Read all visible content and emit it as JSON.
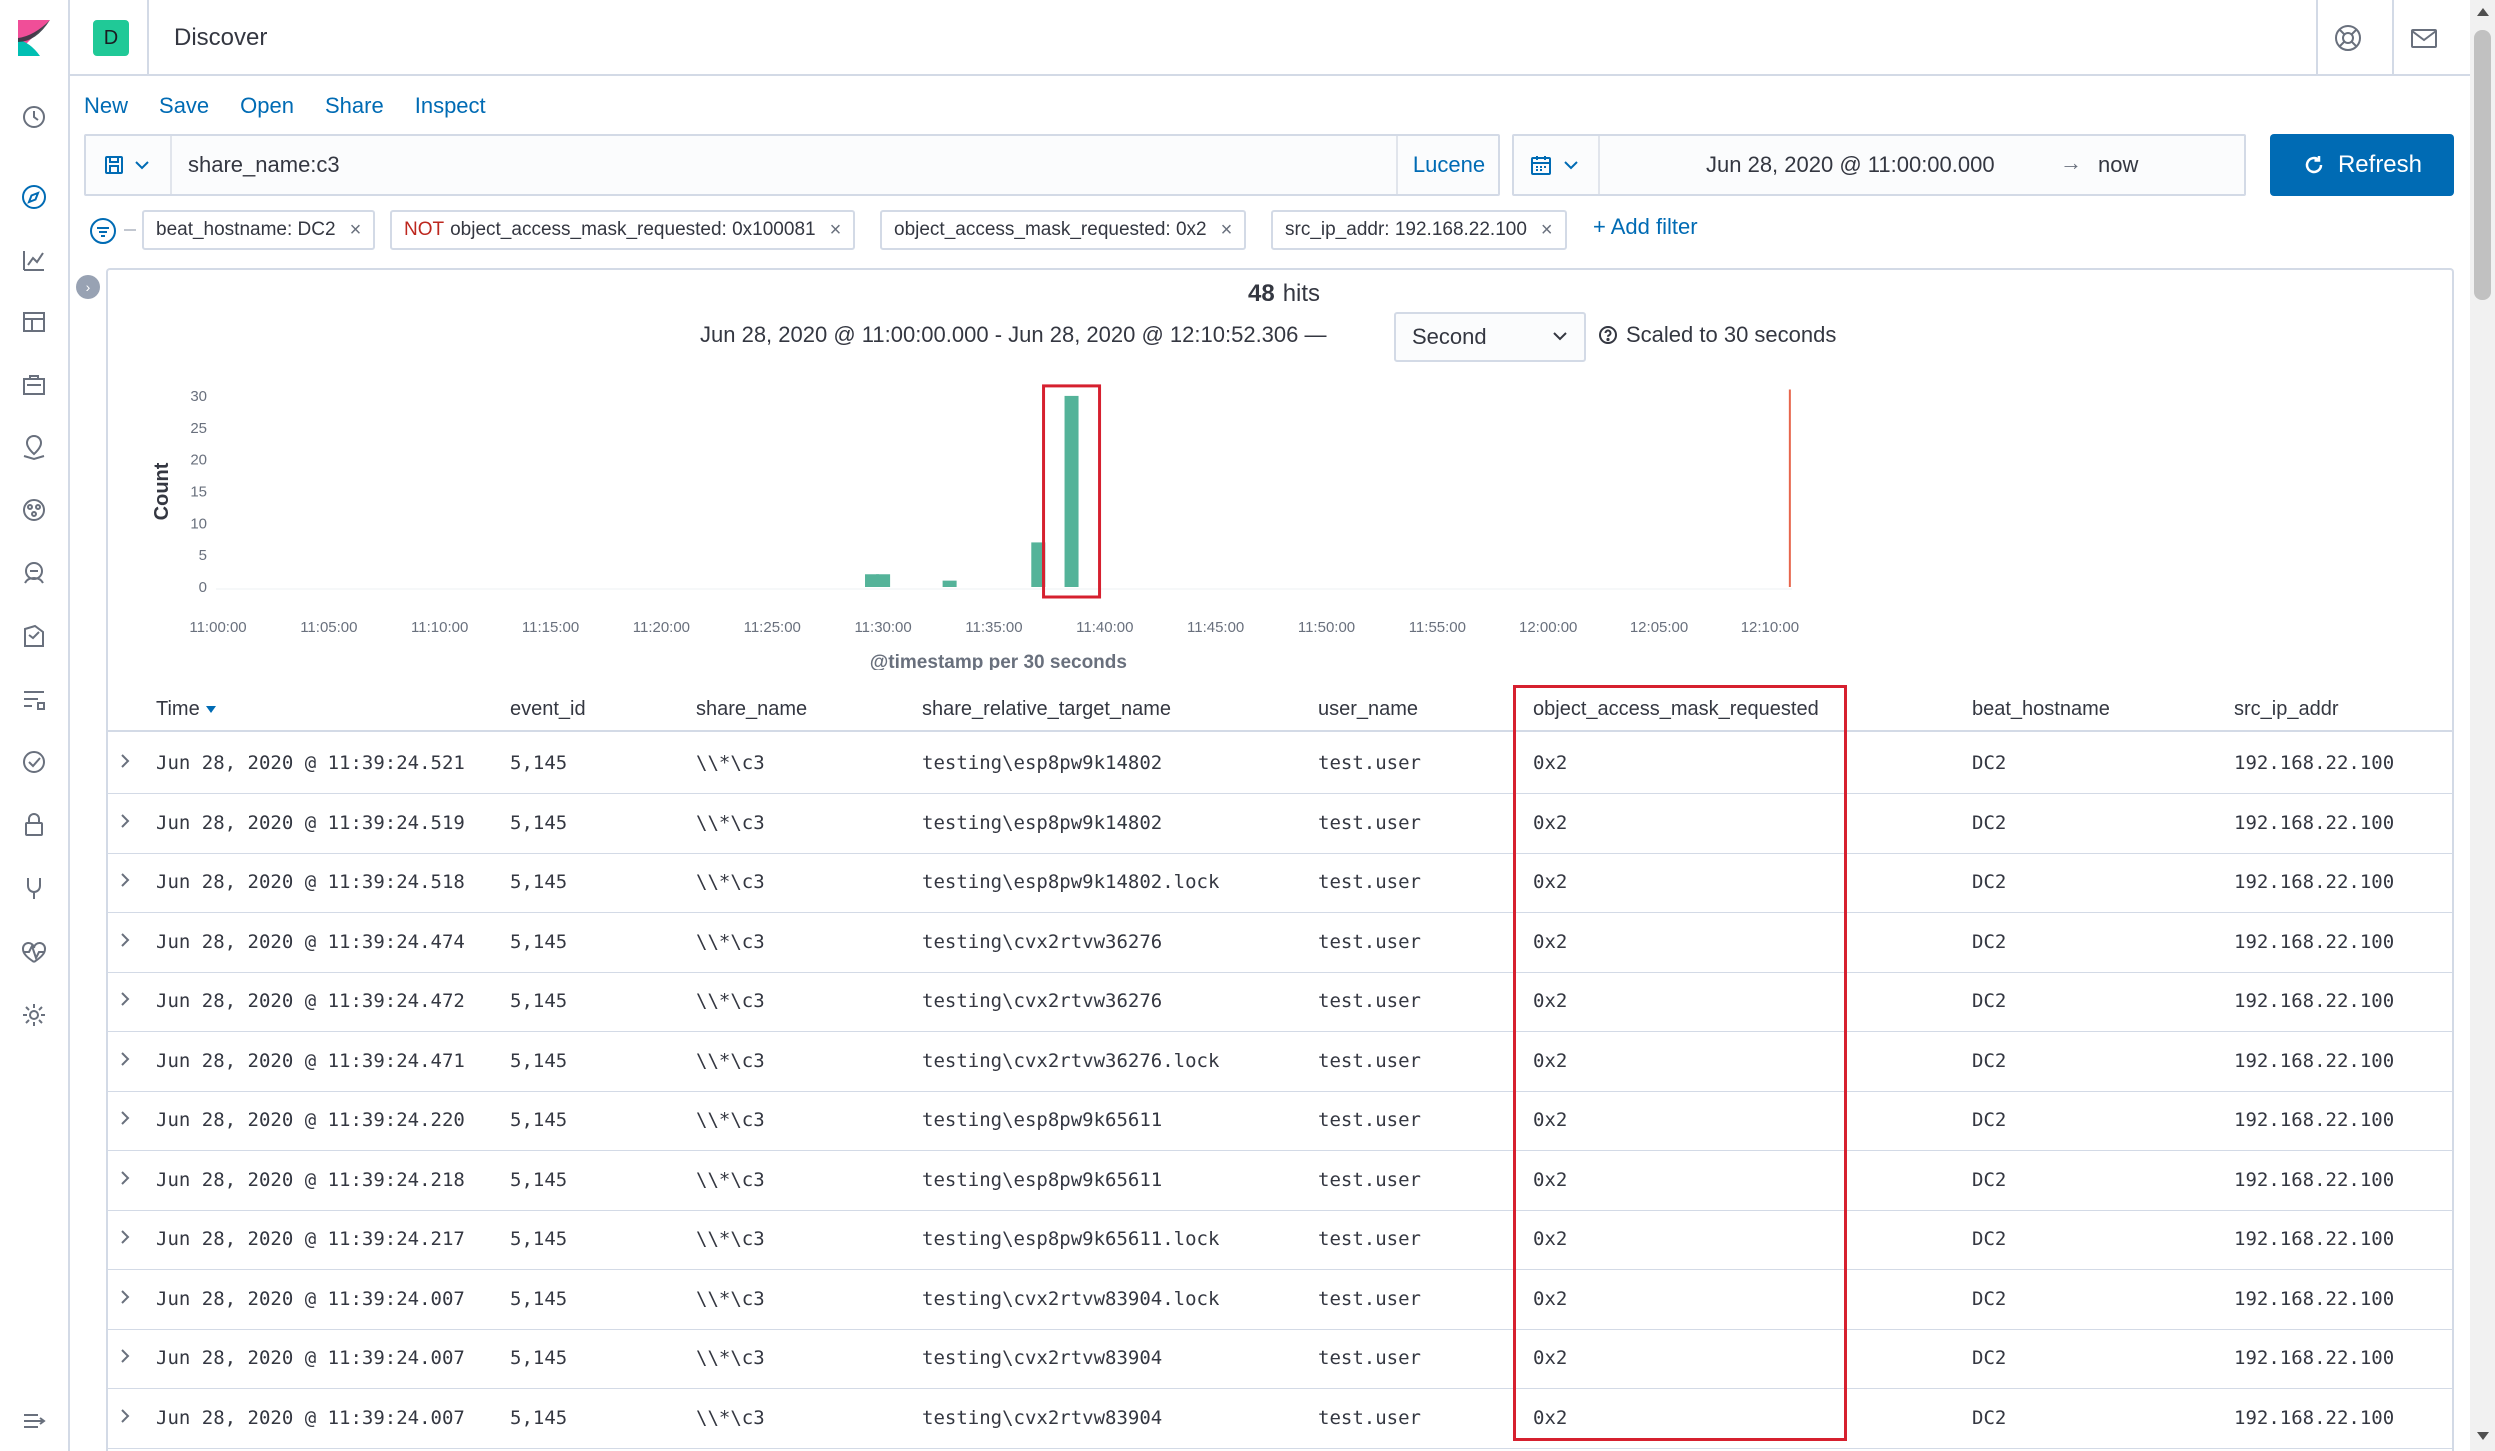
{
  "header": {
    "space_initial": "D",
    "app_title": "Discover"
  },
  "topnav": [
    "New",
    "Save",
    "Open",
    "Share",
    "Inspect"
  ],
  "query": {
    "value": "share_name:c3",
    "language": "Lucene"
  },
  "time": {
    "start": "Jun 28, 2020 @ 11:00:00.000",
    "arrow": "→",
    "end": "now",
    "refresh_label": "Refresh"
  },
  "filters": [
    {
      "negated": false,
      "label": "beat_hostname: DC2"
    },
    {
      "negated": true,
      "neg_label": "NOT",
      "label": "object_access_mask_requested: 0x100081"
    },
    {
      "negated": false,
      "label": "object_access_mask_requested: 0x2"
    },
    {
      "negated": false,
      "label": "src_ip_addr: 192.168.22.100"
    }
  ],
  "add_filter_label": "+ Add filter",
  "summary": {
    "hits_count": "48",
    "hits_label": "hits",
    "range_text": "Jun 28, 2020 @ 11:00:00.000 - Jun 28, 2020 @ 12:10:52.306 —",
    "interval": "Second",
    "scaled_note": "Scaled to 30 seconds"
  },
  "chart_data": {
    "type": "bar",
    "ylabel": "Count",
    "xlabel": "@timestamp per 30 seconds",
    "ylim": [
      0,
      30
    ],
    "yticks": [
      0,
      5,
      10,
      15,
      20,
      25,
      30
    ],
    "xticks": [
      "11:00:00",
      "11:05:00",
      "11:10:00",
      "11:15:00",
      "11:20:00",
      "11:25:00",
      "11:30:00",
      "11:35:00",
      "11:40:00",
      "11:45:00",
      "11:50:00",
      "11:55:00",
      "12:00:00",
      "12:05:00",
      "12:10:00"
    ],
    "bar_minutes": [
      29.5,
      30.0,
      33.0,
      37.0,
      38.5
    ],
    "values": [
      2,
      2,
      1,
      7,
      30
    ],
    "now_marker_minutes": 70.9,
    "color": "#54b399",
    "now_color": "#e7664c",
    "highlight_color": "#d6202f"
  },
  "table": {
    "columns": [
      "Time",
      "event_id",
      "share_name",
      "share_relative_target_name",
      "user_name",
      "object_access_mask_requested",
      "beat_hostname",
      "src_ip_addr"
    ],
    "rows": [
      [
        "Jun 28, 2020 @ 11:39:24.521",
        "5,145",
        "\\\\*\\c3",
        "testing\\esp8pw9k14802",
        "test.user",
        "0x2",
        "DC2",
        "192.168.22.100"
      ],
      [
        "Jun 28, 2020 @ 11:39:24.519",
        "5,145",
        "\\\\*\\c3",
        "testing\\esp8pw9k14802",
        "test.user",
        "0x2",
        "DC2",
        "192.168.22.100"
      ],
      [
        "Jun 28, 2020 @ 11:39:24.518",
        "5,145",
        "\\\\*\\c3",
        "testing\\esp8pw9k14802.lock",
        "test.user",
        "0x2",
        "DC2",
        "192.168.22.100"
      ],
      [
        "Jun 28, 2020 @ 11:39:24.474",
        "5,145",
        "\\\\*\\c3",
        "testing\\cvx2rtvw36276",
        "test.user",
        "0x2",
        "DC2",
        "192.168.22.100"
      ],
      [
        "Jun 28, 2020 @ 11:39:24.472",
        "5,145",
        "\\\\*\\c3",
        "testing\\cvx2rtvw36276",
        "test.user",
        "0x2",
        "DC2",
        "192.168.22.100"
      ],
      [
        "Jun 28, 2020 @ 11:39:24.471",
        "5,145",
        "\\\\*\\c3",
        "testing\\cvx2rtvw36276.lock",
        "test.user",
        "0x2",
        "DC2",
        "192.168.22.100"
      ],
      [
        "Jun 28, 2020 @ 11:39:24.220",
        "5,145",
        "\\\\*\\c3",
        "testing\\esp8pw9k65611",
        "test.user",
        "0x2",
        "DC2",
        "192.168.22.100"
      ],
      [
        "Jun 28, 2020 @ 11:39:24.218",
        "5,145",
        "\\\\*\\c3",
        "testing\\esp8pw9k65611",
        "test.user",
        "0x2",
        "DC2",
        "192.168.22.100"
      ],
      [
        "Jun 28, 2020 @ 11:39:24.217",
        "5,145",
        "\\\\*\\c3",
        "testing\\esp8pw9k65611.lock",
        "test.user",
        "0x2",
        "DC2",
        "192.168.22.100"
      ],
      [
        "Jun 28, 2020 @ 11:39:24.007",
        "5,145",
        "\\\\*\\c3",
        "testing\\cvx2rtvw83904.lock",
        "test.user",
        "0x2",
        "DC2",
        "192.168.22.100"
      ],
      [
        "Jun 28, 2020 @ 11:39:24.007",
        "5,145",
        "\\\\*\\c3",
        "testing\\cvx2rtvw83904",
        "test.user",
        "0x2",
        "DC2",
        "192.168.22.100"
      ],
      [
        "Jun 28, 2020 @ 11:39:24.007",
        "5,145",
        "\\\\*\\c3",
        "testing\\cvx2rtvw83904",
        "test.user",
        "0x2",
        "DC2",
        "192.168.22.100"
      ]
    ]
  },
  "icons": {
    "rail": [
      "clock-icon",
      "compass-icon",
      "visualize-icon",
      "dashboard-icon",
      "canvas-icon",
      "maps-icon",
      "ml-icon",
      "infra-icon",
      "logs-icon",
      "apm-icon",
      "uptime-icon",
      "siem-icon",
      "dev-tools-icon",
      "monitoring-icon",
      "management-icon",
      "collapse-nav-icon"
    ],
    "header": [
      "help-icon",
      "mail-icon"
    ]
  }
}
